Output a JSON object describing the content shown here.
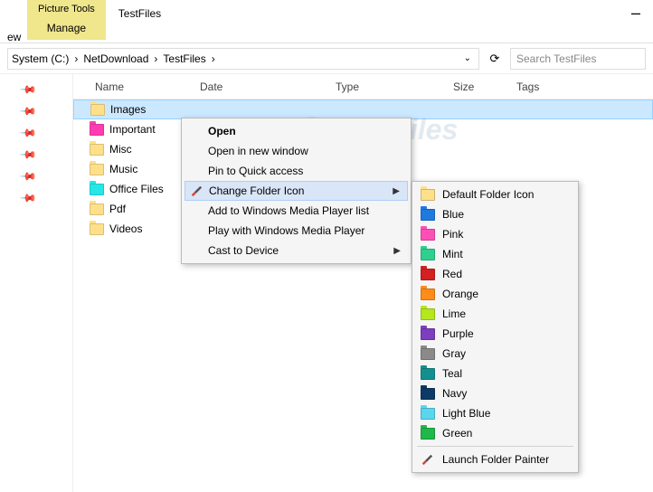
{
  "ribbon": {
    "picture_tools": "Picture Tools",
    "manage": "Manage",
    "ew": "ew",
    "title": "TestFiles"
  },
  "breadcrumb": {
    "items": [
      "System (C:)",
      "NetDownload",
      "TestFiles"
    ],
    "search_placeholder": "Search TestFiles"
  },
  "columns": {
    "name": "Name",
    "date": "Date",
    "type": "Type",
    "size": "Size",
    "tags": "Tags"
  },
  "folders": [
    {
      "label": "Images",
      "color": "#ffe08a",
      "selected": true
    },
    {
      "label": "Important",
      "color": "#ff3db0"
    },
    {
      "label": "Misc",
      "color": "#ffe08a"
    },
    {
      "label": "Music",
      "color": "#ffe08a"
    },
    {
      "label": "Office Files",
      "color": "#26e7e7"
    },
    {
      "label": "Pdf",
      "color": "#ffe08a"
    },
    {
      "label": "Videos",
      "color": "#ffe08a"
    }
  ],
  "context_menu": {
    "open": "Open",
    "open_new": "Open in new window",
    "pin": "Pin to Quick access",
    "change_icon": "Change Folder Icon",
    "wmp_add": "Add to Windows Media Player list",
    "wmp_play": "Play with Windows Media Player",
    "cast": "Cast to Device"
  },
  "submenu": {
    "items": [
      {
        "label": "Default Folder Icon",
        "color": "#ffe08a"
      },
      {
        "label": "Blue",
        "color": "#1f7ae0"
      },
      {
        "label": "Pink",
        "color": "#ff4fb7"
      },
      {
        "label": "Mint",
        "color": "#2fd08f"
      },
      {
        "label": "Red",
        "color": "#d42020"
      },
      {
        "label": "Orange",
        "color": "#ff8c1a"
      },
      {
        "label": "Lime",
        "color": "#b6e61e"
      },
      {
        "label": "Purple",
        "color": "#7b3fbf"
      },
      {
        "label": "Gray",
        "color": "#8a8a8a"
      },
      {
        "label": "Teal",
        "color": "#148f8f"
      },
      {
        "label": "Navy",
        "color": "#0d3a66"
      },
      {
        "label": "Light Blue",
        "color": "#5bd6ef"
      },
      {
        "label": "Green",
        "color": "#1fb84a"
      }
    ],
    "launch": "Launch Folder Painter"
  },
  "watermark": "Snapfiles"
}
